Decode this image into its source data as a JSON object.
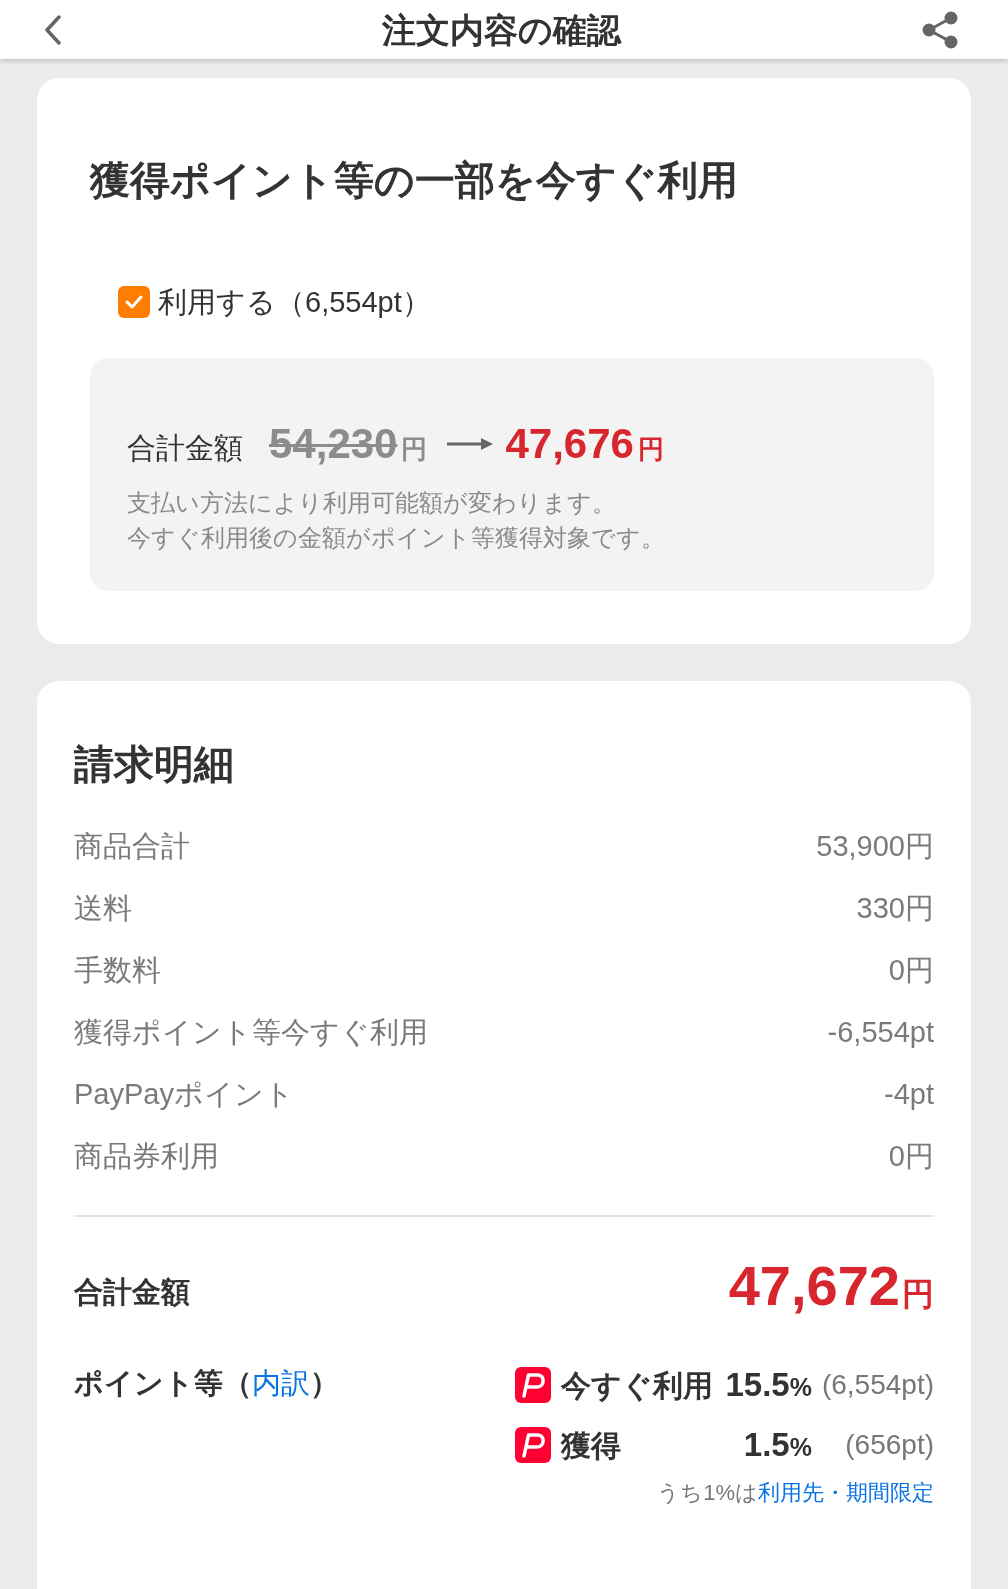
{
  "header": {
    "title": "注文内容の確認"
  },
  "points_card": {
    "title": "獲得ポイント等の一部を今すぐ利用",
    "use_points": {
      "label": "利用する（6,554pt）",
      "checked": true
    },
    "summary": {
      "label": "合計金額",
      "original_amount": "54,230",
      "original_unit": "円",
      "new_amount": "47,676",
      "new_unit": "円",
      "notes": [
        "支払い方法により利用可能額が変わります。",
        "今すぐ利用後の金額がポイント等獲得対象です。"
      ]
    }
  },
  "billing_card": {
    "title": "請求明細",
    "rows": [
      {
        "label": "商品合計",
        "value": "53,900円"
      },
      {
        "label": "送料",
        "value": "330円"
      },
      {
        "label": "手数料",
        "value": "0円"
      },
      {
        "label": "獲得ポイント等今すぐ利用",
        "value": "-6,554pt"
      },
      {
        "label": "PayPayポイント",
        "value": "-4pt"
      },
      {
        "label": "商品券利用",
        "value": "0円"
      }
    ],
    "total": {
      "label": "合計金額",
      "amount": "47,672",
      "unit": "円"
    },
    "points": {
      "label_start": "ポイント等（",
      "link": "内訳",
      "label_end": "）",
      "items": [
        {
          "label": "今すぐ利用",
          "rate": "15.5",
          "rate_unit": "%",
          "amount": "(6,554pt)"
        },
        {
          "label": "獲得",
          "rate": "1.5",
          "rate_unit": "%",
          "amount": "(656pt)"
        }
      ],
      "note": "うち1%は",
      "note_link": "利用先・期間限定"
    }
  }
}
